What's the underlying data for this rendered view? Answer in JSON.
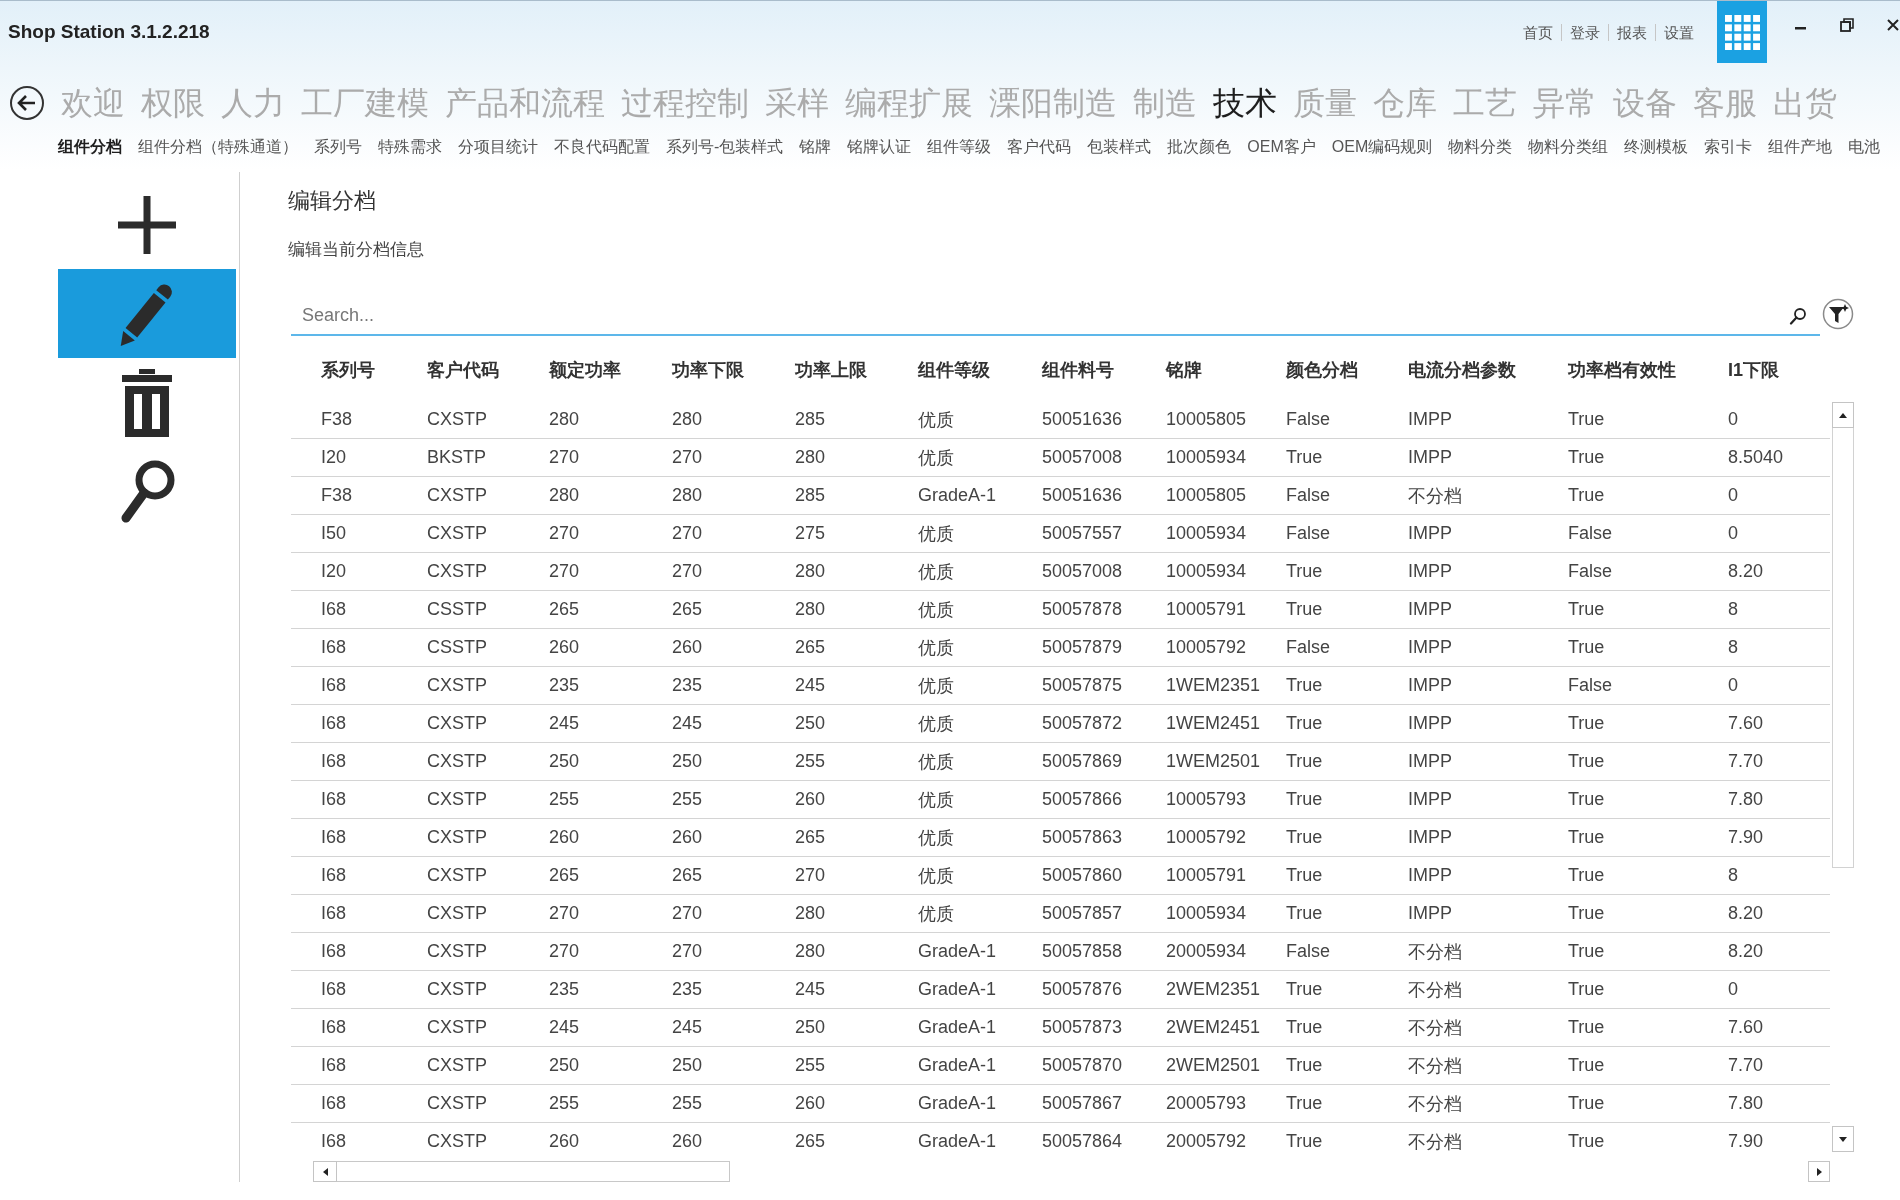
{
  "window": {
    "title": "Shop Station 3.1.2.218"
  },
  "top_links": [
    "首页",
    "登录",
    "报表",
    "设置"
  ],
  "main_nav": [
    {
      "label": "欢迎",
      "selected": false
    },
    {
      "label": "权限",
      "selected": false
    },
    {
      "label": "人力",
      "selected": false
    },
    {
      "label": "工厂建模",
      "selected": false
    },
    {
      "label": "产品和流程",
      "selected": false
    },
    {
      "label": "过程控制",
      "selected": false
    },
    {
      "label": "采样",
      "selected": false
    },
    {
      "label": "编程扩展",
      "selected": false
    },
    {
      "label": "溧阳制造",
      "selected": false
    },
    {
      "label": "制造",
      "selected": false
    },
    {
      "label": "技术",
      "selected": true
    },
    {
      "label": "质量",
      "selected": false
    },
    {
      "label": "仓库",
      "selected": false
    },
    {
      "label": "工艺",
      "selected": false
    },
    {
      "label": "异常",
      "selected": false
    },
    {
      "label": "设备",
      "selected": false
    },
    {
      "label": "客服",
      "selected": false
    },
    {
      "label": "出货",
      "selected": false
    }
  ],
  "sub_nav": [
    {
      "label": "组件分档",
      "selected": true
    },
    {
      "label": "组件分档（特殊通道）",
      "selected": false
    },
    {
      "label": "系列号",
      "selected": false
    },
    {
      "label": "特殊需求",
      "selected": false
    },
    {
      "label": "分项目统计",
      "selected": false
    },
    {
      "label": "不良代码配置",
      "selected": false
    },
    {
      "label": "系列号-包装样式",
      "selected": false
    },
    {
      "label": "铭牌",
      "selected": false
    },
    {
      "label": "铭牌认证",
      "selected": false
    },
    {
      "label": "组件等级",
      "selected": false
    },
    {
      "label": "客户代码",
      "selected": false
    },
    {
      "label": "包装样式",
      "selected": false
    },
    {
      "label": "批次颜色",
      "selected": false
    },
    {
      "label": "OEM客户",
      "selected": false
    },
    {
      "label": "OEM编码规则",
      "selected": false
    },
    {
      "label": "物料分类",
      "selected": false
    },
    {
      "label": "物料分类组",
      "selected": false
    },
    {
      "label": "终测模板",
      "selected": false
    },
    {
      "label": "索引卡",
      "selected": false
    },
    {
      "label": "组件产地",
      "selected": false
    },
    {
      "label": "电池",
      "selected": false
    }
  ],
  "sidebar": {
    "items": [
      {
        "kind": "add",
        "selected": false
      },
      {
        "kind": "edit",
        "selected": true
      },
      {
        "kind": "delete",
        "selected": false
      },
      {
        "kind": "search",
        "selected": false
      }
    ]
  },
  "page": {
    "title": "编辑分档",
    "subtitle": "编辑当前分档信息"
  },
  "search": {
    "placeholder": "Search..."
  },
  "table": {
    "columns": [
      "系列号",
      "客户代码",
      "额定功率",
      "功率下限",
      "功率上限",
      "组件等级",
      "组件料号",
      "铭牌",
      "颜色分档",
      "电流分档参数",
      "功率档有效性",
      "I1下限"
    ],
    "rows": [
      [
        "F38",
        "CXSTP",
        "280",
        "280",
        "285",
        "优质",
        "50051636",
        "10005805",
        "False",
        "IMPP",
        "True",
        "0"
      ],
      [
        "I20",
        "BKSTP",
        "270",
        "270",
        "280",
        "优质",
        "50057008",
        "10005934",
        "True",
        "IMPP",
        "True",
        "8.5040"
      ],
      [
        "F38",
        "CXSTP",
        "280",
        "280",
        "285",
        "GradeA-1",
        "50051636",
        "10005805",
        "False",
        "不分档",
        "True",
        "0"
      ],
      [
        "I50",
        "CXSTP",
        "270",
        "270",
        "275",
        "优质",
        "50057557",
        "10005934",
        "False",
        "IMPP",
        "False",
        "0"
      ],
      [
        "I20",
        "CXSTP",
        "270",
        "270",
        "280",
        "优质",
        "50057008",
        "10005934",
        "True",
        "IMPP",
        "False",
        "8.20"
      ],
      [
        "I68",
        "CSSTP",
        "265",
        "265",
        "280",
        "优质",
        "50057878",
        "10005791",
        "True",
        "IMPP",
        "True",
        "8"
      ],
      [
        "I68",
        "CSSTP",
        "260",
        "260",
        "265",
        "优质",
        "50057879",
        "10005792",
        "False",
        "IMPP",
        "True",
        "8"
      ],
      [
        "I68",
        "CXSTP",
        "235",
        "235",
        "245",
        "优质",
        "50057875",
        "1WEM2351",
        "True",
        "IMPP",
        "False",
        "0"
      ],
      [
        "I68",
        "CXSTP",
        "245",
        "245",
        "250",
        "优质",
        "50057872",
        "1WEM2451",
        "True",
        "IMPP",
        "True",
        "7.60"
      ],
      [
        "I68",
        "CXSTP",
        "250",
        "250",
        "255",
        "优质",
        "50057869",
        "1WEM2501",
        "True",
        "IMPP",
        "True",
        "7.70"
      ],
      [
        "I68",
        "CXSTP",
        "255",
        "255",
        "260",
        "优质",
        "50057866",
        "10005793",
        "True",
        "IMPP",
        "True",
        "7.80"
      ],
      [
        "I68",
        "CXSTP",
        "260",
        "260",
        "265",
        "优质",
        "50057863",
        "10005792",
        "True",
        "IMPP",
        "True",
        "7.90"
      ],
      [
        "I68",
        "CXSTP",
        "265",
        "265",
        "270",
        "优质",
        "50057860",
        "10005791",
        "True",
        "IMPP",
        "True",
        "8"
      ],
      [
        "I68",
        "CXSTP",
        "270",
        "270",
        "280",
        "优质",
        "50057857",
        "10005934",
        "True",
        "IMPP",
        "True",
        "8.20"
      ],
      [
        "I68",
        "CXSTP",
        "270",
        "270",
        "280",
        "GradeA-1",
        "50057858",
        "20005934",
        "False",
        "不分档",
        "True",
        "8.20"
      ],
      [
        "I68",
        "CXSTP",
        "235",
        "235",
        "245",
        "GradeA-1",
        "50057876",
        "2WEM2351",
        "True",
        "不分档",
        "True",
        "0"
      ],
      [
        "I68",
        "CXSTP",
        "245",
        "245",
        "250",
        "GradeA-1",
        "50057873",
        "2WEM2451",
        "True",
        "不分档",
        "True",
        "7.60"
      ],
      [
        "I68",
        "CXSTP",
        "250",
        "250",
        "255",
        "GradeA-1",
        "50057870",
        "2WEM2501",
        "True",
        "不分档",
        "True",
        "7.70"
      ],
      [
        "I68",
        "CXSTP",
        "255",
        "255",
        "260",
        "GradeA-1",
        "50057867",
        "20005793",
        "True",
        "不分档",
        "True",
        "7.80"
      ],
      [
        "I68",
        "CXSTP",
        "260",
        "260",
        "265",
        "GradeA-1",
        "50057864",
        "20005792",
        "True",
        "不分档",
        "True",
        "7.90"
      ]
    ]
  }
}
